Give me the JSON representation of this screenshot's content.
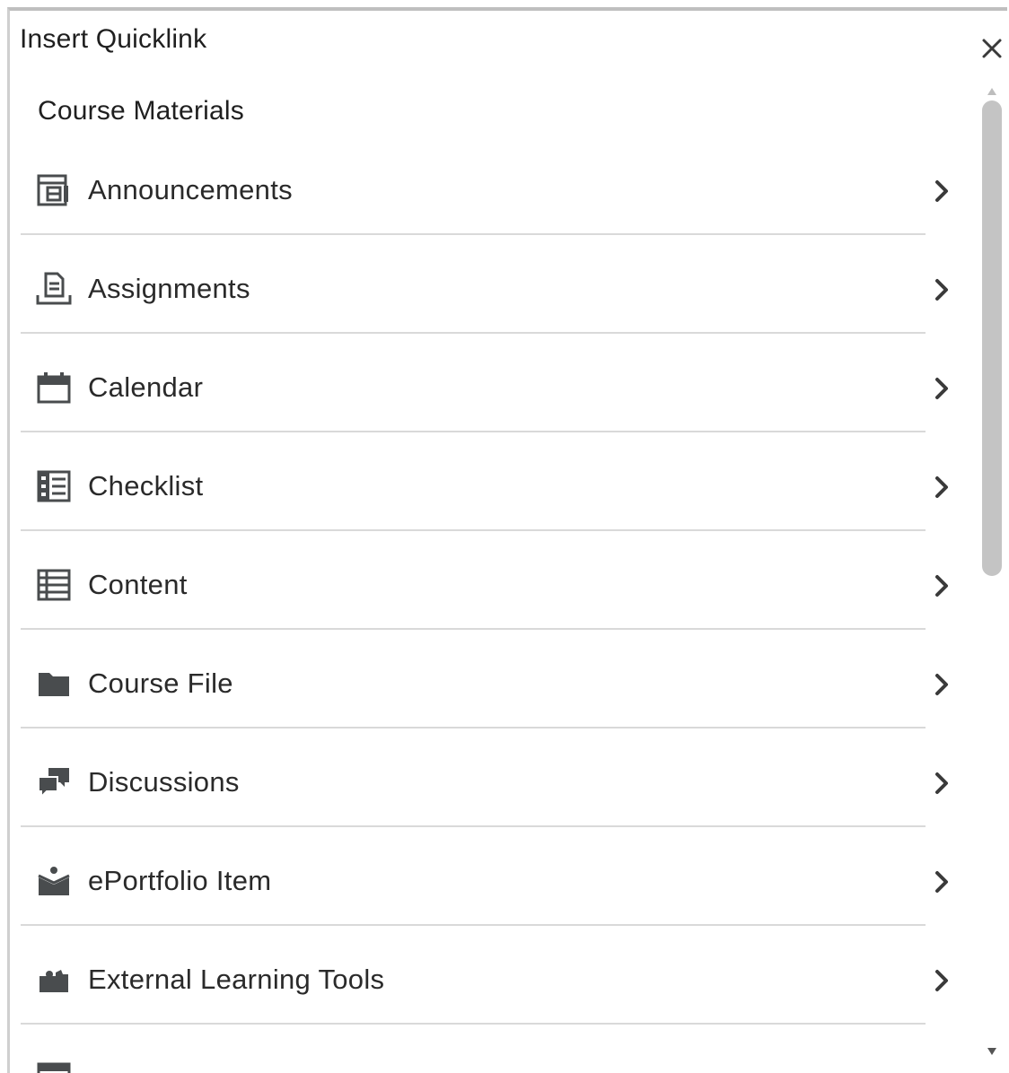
{
  "dialog": {
    "title": "Insert Quicklink",
    "close_icon": "close-icon"
  },
  "section": {
    "heading": "Course Materials"
  },
  "items": [
    {
      "label": "Announcements",
      "icon": "announcements-icon"
    },
    {
      "label": "Assignments",
      "icon": "assignments-icon"
    },
    {
      "label": "Calendar",
      "icon": "calendar-icon"
    },
    {
      "label": "Checklist",
      "icon": "checklist-icon"
    },
    {
      "label": "Content",
      "icon": "content-icon"
    },
    {
      "label": "Course File",
      "icon": "folder-icon"
    },
    {
      "label": "Discussions",
      "icon": "discussions-icon"
    },
    {
      "label": "ePortfolio Item",
      "icon": "eportfolio-icon"
    },
    {
      "label": "External Learning Tools",
      "icon": "puzzle-icon"
    },
    {
      "label": "",
      "icon": "form-icon"
    }
  ],
  "colors": {
    "icon": "#494c4e",
    "text": "#202122",
    "divider": "#d9d9d9",
    "scroll_thumb": "#c4c4c4"
  }
}
